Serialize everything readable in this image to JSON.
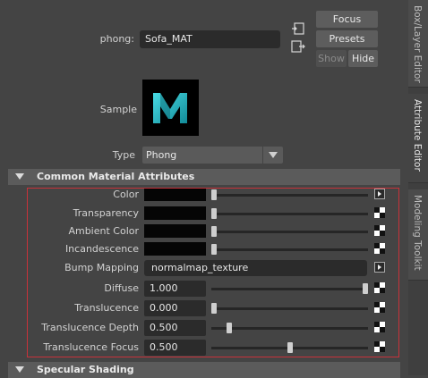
{
  "node": {
    "type_label": "phong:",
    "name_value": "Sofa_MAT"
  },
  "buttons": {
    "focus": "Focus",
    "presets": "Presets",
    "show": "Show",
    "hide": "Hide"
  },
  "sample": {
    "label": "Sample",
    "logo_letter": "M"
  },
  "type_select": {
    "label": "Type",
    "value": "Phong"
  },
  "sections": {
    "common": "Common Material Attributes",
    "specular": "Specular Shading"
  },
  "attributes": [
    {
      "label": "Color",
      "kind": "color",
      "slider": 0.0,
      "map": "arrow"
    },
    {
      "label": "Transparency",
      "kind": "color",
      "slider": 0.0,
      "map": "checker"
    },
    {
      "label": "Ambient Color",
      "kind": "color",
      "slider": 0.0,
      "map": "checker"
    },
    {
      "label": "Incandescence",
      "kind": "color",
      "slider": 0.0,
      "map": "checker"
    },
    {
      "label": "Bump Mapping",
      "kind": "text",
      "value": "normalmap_texture",
      "map": "arrow"
    },
    {
      "label": "Diffuse",
      "kind": "number",
      "value": "1.000",
      "slider": 1.0,
      "map": "checker"
    },
    {
      "label": "Translucence",
      "kind": "number",
      "value": "0.000",
      "slider": 0.0,
      "map": "checker"
    },
    {
      "label": "Translucence Depth",
      "kind": "number",
      "value": "0.500",
      "slider": 0.1,
      "map": "checker"
    },
    {
      "label": "Translucence Focus",
      "kind": "number",
      "value": "0.500",
      "slider": 0.5,
      "map": "checker"
    }
  ],
  "side_tabs": [
    "Box/Layer Editor",
    "Attribute Editor",
    "Modeling Toolkit"
  ],
  "colors": {
    "accent_highlight": "#c8323a",
    "logo_teal": "#2fc6d2",
    "panel_bg": "#444444"
  }
}
